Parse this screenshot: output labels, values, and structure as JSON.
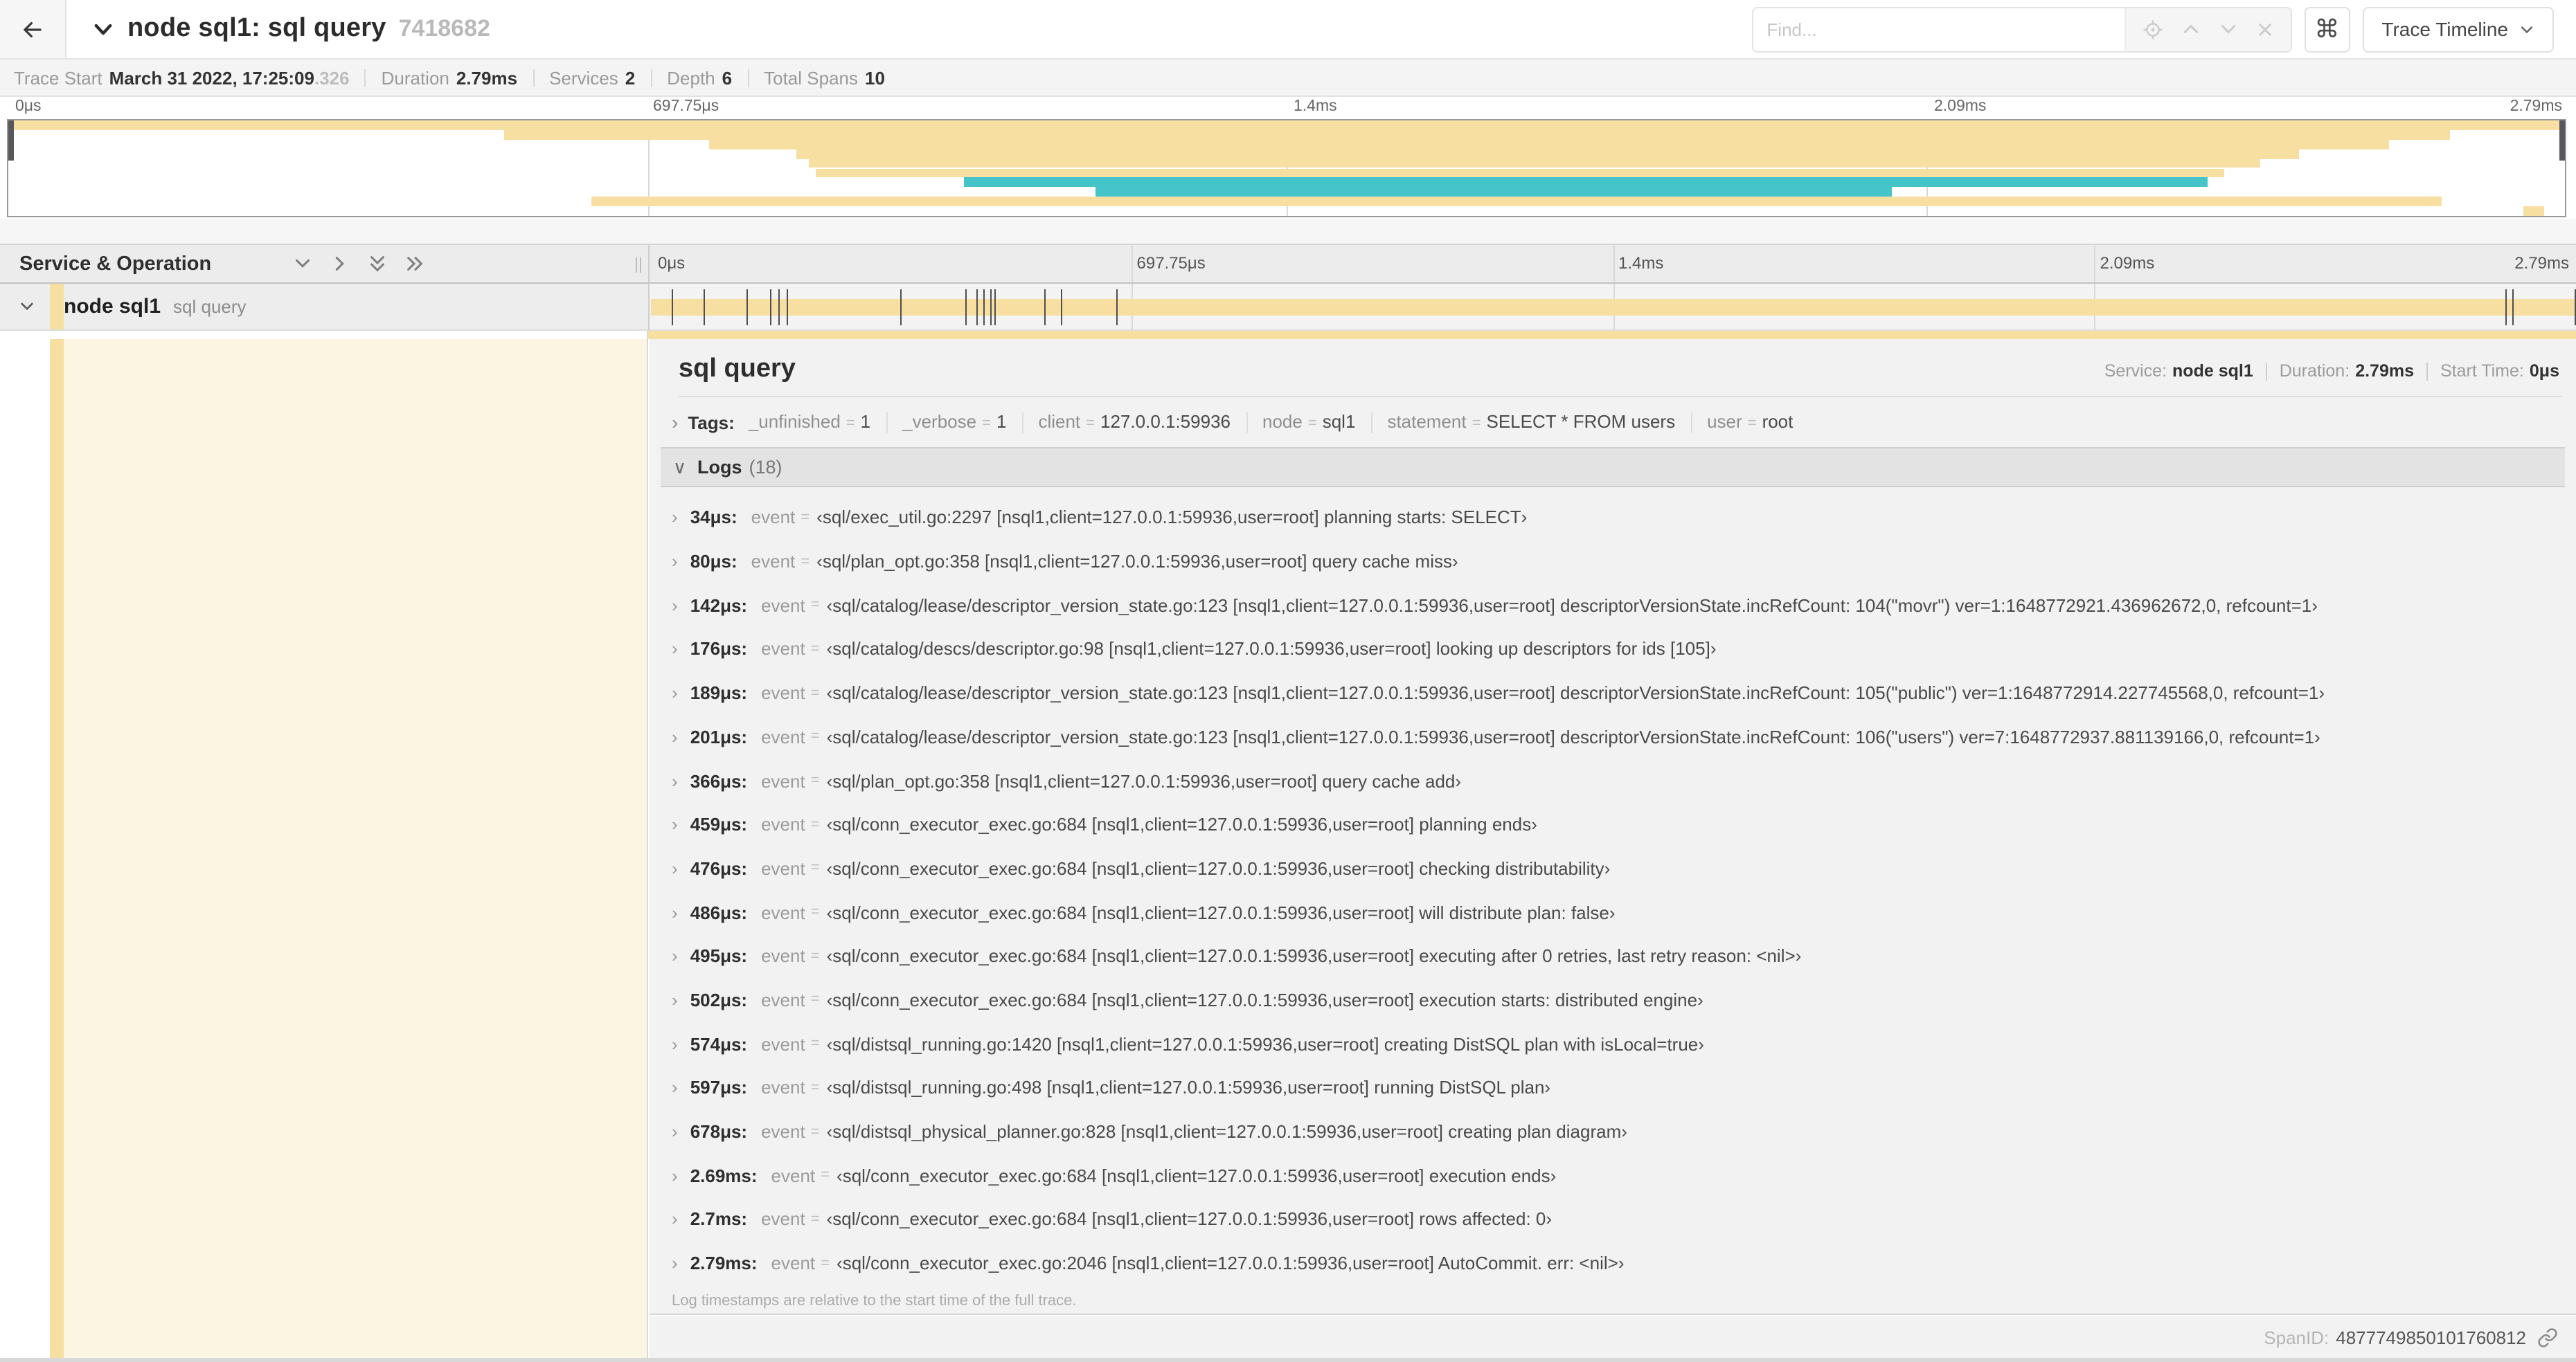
{
  "header": {
    "title": "node sql1: sql query",
    "trace_id": "7418682",
    "find_placeholder": "Find...",
    "shortcuts_glyph": "⌘",
    "view_dropdown": "Trace Timeline"
  },
  "trace_meta": {
    "trace_start_label": "Trace Start",
    "trace_start": "March 31 2022, 17:25:09",
    "trace_start_frac": ".326",
    "duration_label": "Duration",
    "duration": "2.79ms",
    "services_label": "Services",
    "services": "2",
    "depth_label": "Depth",
    "depth": "6",
    "total_spans_label": "Total Spans",
    "total_spans": "10"
  },
  "timeline": {
    "duration_us": 2790,
    "ticks": [
      "0μs",
      "697.75μs",
      "1.4ms",
      "2.09ms",
      "2.79ms"
    ]
  },
  "minimap": {
    "rows": [
      {
        "start": 0.0,
        "end": 1.0,
        "color": "orange"
      },
      {
        "start": 0.194,
        "end": 0.955,
        "color": "orange"
      },
      {
        "start": 0.274,
        "end": 0.931,
        "color": "orange"
      },
      {
        "start": 0.308,
        "end": 0.896,
        "color": "orange"
      },
      {
        "start": 0.313,
        "end": 0.881,
        "color": "orange"
      },
      {
        "start": 0.316,
        "end": 0.867,
        "color": "orange"
      },
      {
        "start": 0.374,
        "end": 0.86,
        "color": "teal"
      },
      {
        "start": 0.425,
        "end": 0.737,
        "color": "teal"
      },
      {
        "start": 0.228,
        "end": 0.952,
        "color": "orange"
      },
      {
        "start": 0.984,
        "end": 0.992,
        "color": "orange"
      }
    ]
  },
  "span_table": {
    "header": "Service & Operation",
    "row": {
      "service": "node sql1",
      "operation": "sql query"
    }
  },
  "detail": {
    "title": "sql query",
    "service_label": "Service:",
    "service": "node sql1",
    "duration_label": "Duration:",
    "duration": "2.79ms",
    "start_label": "Start Time:",
    "start": "0μs",
    "tags": {
      "label": "Tags:",
      "items": [
        {
          "key": "_unfinished",
          "value": "1"
        },
        {
          "key": "_verbose",
          "value": "1"
        },
        {
          "key": "client",
          "value": "127.0.0.1:59936"
        },
        {
          "key": "node",
          "value": "sql1"
        },
        {
          "key": "statement",
          "value": "SELECT * FROM users"
        },
        {
          "key": "user",
          "value": "root"
        }
      ]
    },
    "logs": {
      "label": "Logs",
      "count_display": "(18)",
      "entries": [
        {
          "t": "34μs",
          "us": 34,
          "key": "event",
          "value": "‹sql/exec_util.go:2297 [nsql1,client=127.0.0.1:59936,user=root] planning starts: SELECT›"
        },
        {
          "t": "80μs",
          "us": 80,
          "key": "event",
          "value": "‹sql/plan_opt.go:358 [nsql1,client=127.0.0.1:59936,user=root] query cache miss›"
        },
        {
          "t": "142μs",
          "us": 142,
          "key": "event",
          "value": "‹sql/catalog/lease/descriptor_version_state.go:123 [nsql1,client=127.0.0.1:59936,user=root] descriptorVersionState.incRefCount: 104(\"movr\") ver=1:1648772921.436962672,0, refcount=1›"
        },
        {
          "t": "176μs",
          "us": 176,
          "key": "event",
          "value": "‹sql/catalog/descs/descriptor.go:98 [nsql1,client=127.0.0.1:59936,user=root] looking up descriptors for ids [105]›"
        },
        {
          "t": "189μs",
          "us": 189,
          "key": "event",
          "value": "‹sql/catalog/lease/descriptor_version_state.go:123 [nsql1,client=127.0.0.1:59936,user=root] descriptorVersionState.incRefCount: 105(\"public\") ver=1:1648772914.227745568,0, refcount=1›"
        },
        {
          "t": "201μs",
          "us": 201,
          "key": "event",
          "value": "‹sql/catalog/lease/descriptor_version_state.go:123 [nsql1,client=127.0.0.1:59936,user=root] descriptorVersionState.incRefCount: 106(\"users\") ver=7:1648772937.881139166,0, refcount=1›"
        },
        {
          "t": "366μs",
          "us": 366,
          "key": "event",
          "value": "‹sql/plan_opt.go:358 [nsql1,client=127.0.0.1:59936,user=root] query cache add›"
        },
        {
          "t": "459μs",
          "us": 459,
          "key": "event",
          "value": "‹sql/conn_executor_exec.go:684 [nsql1,client=127.0.0.1:59936,user=root] planning ends›"
        },
        {
          "t": "476μs",
          "us": 476,
          "key": "event",
          "value": "‹sql/conn_executor_exec.go:684 [nsql1,client=127.0.0.1:59936,user=root] checking distributability›"
        },
        {
          "t": "486μs",
          "us": 486,
          "key": "event",
          "value": "‹sql/conn_executor_exec.go:684 [nsql1,client=127.0.0.1:59936,user=root] will distribute plan: false›"
        },
        {
          "t": "495μs",
          "us": 495,
          "key": "event",
          "value": "‹sql/conn_executor_exec.go:684 [nsql1,client=127.0.0.1:59936,user=root] executing after 0 retries, last retry reason: <nil>›"
        },
        {
          "t": "502μs",
          "us": 502,
          "key": "event",
          "value": "‹sql/conn_executor_exec.go:684 [nsql1,client=127.0.0.1:59936,user=root] execution starts: distributed engine›"
        },
        {
          "t": "574μs",
          "us": 574,
          "key": "event",
          "value": "‹sql/distsql_running.go:1420 [nsql1,client=127.0.0.1:59936,user=root] creating DistSQL plan with isLocal=true›"
        },
        {
          "t": "597μs",
          "us": 597,
          "key": "event",
          "value": "‹sql/distsql_running.go:498 [nsql1,client=127.0.0.1:59936,user=root] running DistSQL plan›"
        },
        {
          "t": "678μs",
          "us": 678,
          "key": "event",
          "value": "‹sql/distsql_physical_planner.go:828 [nsql1,client=127.0.0.1:59936,user=root] creating plan diagram›"
        },
        {
          "t": "2.69ms",
          "us": 2690,
          "key": "event",
          "value": "‹sql/conn_executor_exec.go:684 [nsql1,client=127.0.0.1:59936,user=root] execution ends›"
        },
        {
          "t": "2.7ms",
          "us": 2700,
          "key": "event",
          "value": "‹sql/conn_executor_exec.go:684 [nsql1,client=127.0.0.1:59936,user=root] rows affected: 0›"
        },
        {
          "t": "2.79ms",
          "us": 2790,
          "key": "event",
          "value": "‹sql/conn_executor_exec.go:2046 [nsql1,client=127.0.0.1:59936,user=root] AutoCommit. err: <nil>›"
        }
      ],
      "footnote": "Log timestamps are relative to the start time of the full trace."
    },
    "span_id_label": "SpanID:",
    "span_id": "4877749850101760812"
  },
  "colors": {
    "span_orange": "#f7dfa2",
    "span_teal": "#45c5c9",
    "expanded_bg": "#fcf5e1"
  }
}
